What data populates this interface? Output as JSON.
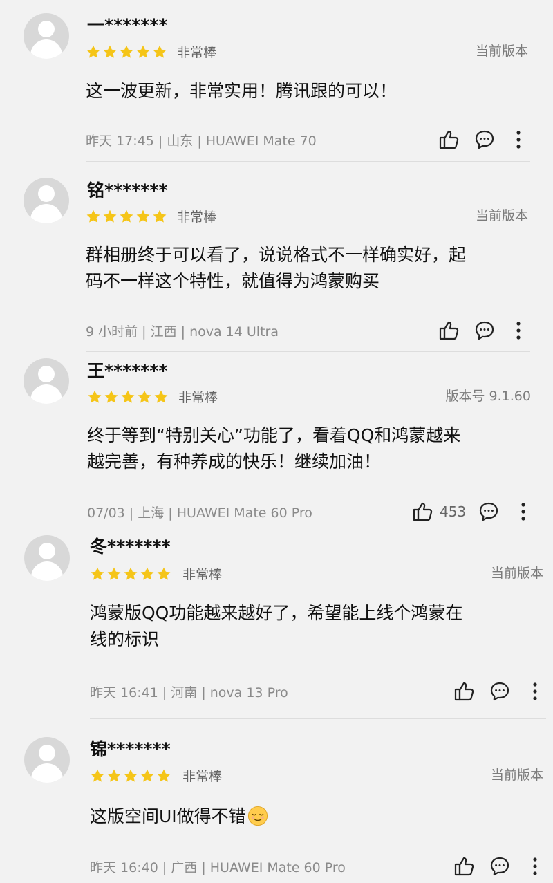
{
  "colors": {
    "star": "#f5c518",
    "background": "#f2f2f2",
    "text_primary": "#111111",
    "text_secondary": "#8a8a8a"
  },
  "icons": {
    "like": "thumbs-up-icon",
    "comment": "comment-bubble-icon",
    "more": "more-vertical-icon",
    "avatar": "default-avatar-icon",
    "star": "star-icon",
    "emoji": "relieved-face-emoji"
  },
  "reviews": [
    {
      "username": "一*******",
      "stars": 5,
      "rating_label": "非常棒",
      "version": "当前版本",
      "content_lines": [
        "这一波更新，非常实用！腾讯跟的可以！"
      ],
      "meta": "昨天 17:45 | 山东 | HUAWEI Mate 70",
      "like_count": ""
    },
    {
      "username": "铭*******",
      "stars": 5,
      "rating_label": "非常棒",
      "version": "当前版本",
      "content_lines": [
        "群相册终于可以看了，说说格式不一样确实好，起",
        "码不一样这个特性，就值得为鸿蒙购买"
      ],
      "meta": "9 小时前 | 江西 | nova 14 Ultra",
      "like_count": ""
    },
    {
      "username": "王*******",
      "stars": 5,
      "rating_label": "非常棒",
      "version": "版本号 9.1.60",
      "content_lines": [
        "终于等到“特别关心”功能了，看着QQ和鸿蒙越来",
        "越完善，有种养成的快乐！继续加油！"
      ],
      "meta": "07/03 | 上海 | HUAWEI Mate 60 Pro",
      "like_count": "453"
    },
    {
      "username": "冬*******",
      "stars": 5,
      "rating_label": "非常棒",
      "version": "当前版本",
      "content_lines": [
        "鸿蒙版QQ功能越来越好了，希望能上线个鸿蒙在",
        "线的标识"
      ],
      "meta": "昨天 16:41 | 河南 | nova 13 Pro",
      "like_count": ""
    },
    {
      "username": "锦*******",
      "stars": 5,
      "rating_label": "非常棒",
      "version": "当前版本",
      "content_lines": [
        "这版空间UI做得不错"
      ],
      "meta": "昨天 16:40 | 广西 | HUAWEI Mate 60 Pro",
      "like_count": ""
    }
  ]
}
